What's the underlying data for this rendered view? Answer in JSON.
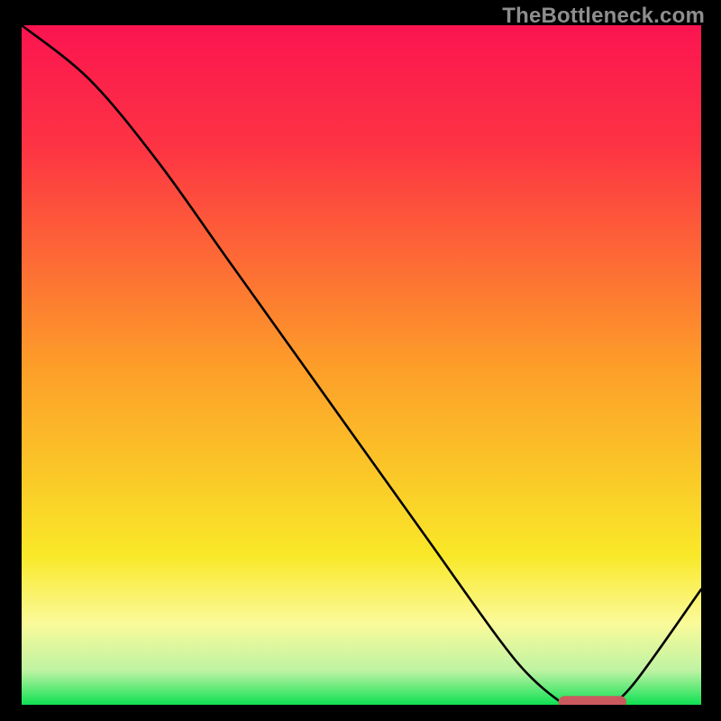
{
  "watermark": "TheBottleneck.com",
  "colors": {
    "curve": "#000000",
    "marker": "#cb5a5e",
    "frame_bg": "#000000",
    "gradient_stops": [
      {
        "offset": 0.0,
        "color": "#fb1450"
      },
      {
        "offset": 0.18,
        "color": "#fd3443"
      },
      {
        "offset": 0.5,
        "color": "#fd9d29"
      },
      {
        "offset": 0.78,
        "color": "#f9e828"
      },
      {
        "offset": 0.88,
        "color": "#fbfa9a"
      },
      {
        "offset": 0.95,
        "color": "#bef3a3"
      },
      {
        "offset": 1.0,
        "color": "#0fe153"
      }
    ]
  },
  "chart_data": {
    "type": "line",
    "title": "",
    "xlabel": "",
    "ylabel": "",
    "xlim": [
      0,
      100
    ],
    "ylim": [
      0,
      100
    ],
    "x": [
      0,
      10,
      20,
      30,
      40,
      50,
      60,
      70,
      75,
      80,
      82,
      86,
      90,
      100
    ],
    "values": [
      100,
      92,
      80,
      66,
      52,
      38,
      24,
      10,
      4,
      0,
      0,
      0,
      3,
      17
    ],
    "optimum_range_x": [
      79,
      89
    ],
    "optimum_range_y": 0.4,
    "marker_thickness": 1.8
  }
}
